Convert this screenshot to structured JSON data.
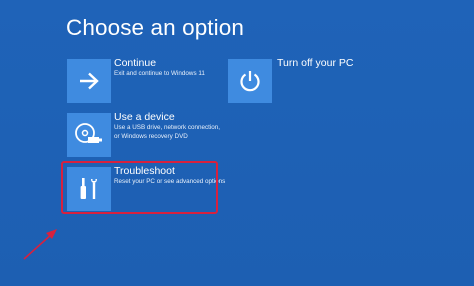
{
  "page": {
    "title": "Choose an option"
  },
  "options": {
    "continue": {
      "title": "Continue",
      "description": "Exit and continue to Windows 11",
      "icon": "arrow-right-icon"
    },
    "use_device": {
      "title": "Use a device",
      "description_line1": "Use a USB drive, network connection,",
      "description_line2": "or Windows recovery DVD",
      "icon": "disc-usb-icon"
    },
    "troubleshoot": {
      "title": "Troubleshoot",
      "description": "Reset your PC or see advanced options",
      "icon": "tools-icon"
    },
    "turn_off": {
      "title": "Turn off your PC",
      "icon": "power-icon"
    }
  },
  "annotations": {
    "highlight_color": "#d8213e",
    "arrow_color": "#d8213e"
  },
  "colors": {
    "background": "#1d5fb2",
    "tile": "#3f8be0",
    "text": "#ffffff"
  }
}
